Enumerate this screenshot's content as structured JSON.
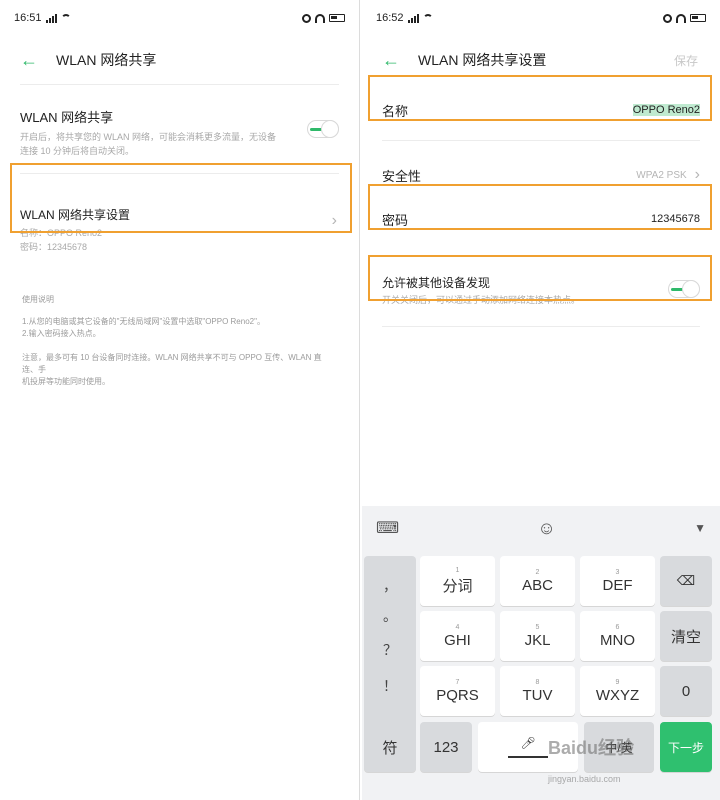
{
  "left": {
    "status": {
      "time": "16:51",
      "net": "4G"
    },
    "title": "WLAN 网络共享",
    "hotspot": {
      "label": "WLAN 网络共享",
      "desc1": "开启后，将共享您的 WLAN 网络，可能会消耗更多流量，无设备",
      "desc2": "连接 10 分钟后将自动关闭。",
      "enabled": true
    },
    "settings": {
      "label": "WLAN 网络共享设置",
      "name_line": "名称：OPPO Reno2",
      "pwd_line": "密码：12345678"
    },
    "tips": {
      "heading": "使用说明",
      "line1": "1.从您的电脑或其它设备的\"无线局域网\"设置中选取\"OPPO Reno2\"。",
      "line2": "2.输入密码接入热点。",
      "line3": "注意，最多可有 10 台设备同时连接。WLAN 网络共享不可与 OPPO 互传、WLAN 直连、手",
      "line4": "机投屏等功能同时使用。"
    }
  },
  "right": {
    "status": {
      "time": "16:52",
      "net": "4G"
    },
    "title": "WLAN 网络共享设置",
    "save": "保存",
    "name": {
      "label": "名称",
      "value": "OPPO Reno2"
    },
    "security": {
      "label": "安全性",
      "value": "WPA2 PSK"
    },
    "password": {
      "label": "密码",
      "value": "12345678"
    },
    "discover": {
      "label": "允许被其他设备发现",
      "desc": "开关关闭后，可以通过手动添加网络连接本热点。",
      "enabled": true
    }
  },
  "keyboard": {
    "sym1": "，",
    "sym2": "。",
    "sym3": "？",
    "sym4": "！",
    "k1_num": "1",
    "k1": "分词",
    "k2_num": "2",
    "k2": "ABC",
    "k3_num": "3",
    "k3": "DEF",
    "k4_num": "4",
    "k4": "GHI",
    "k5_num": "5",
    "k5": "JKL",
    "k6_num": "6",
    "k6": "MNO",
    "k7_num": "7",
    "k7": "PQRS",
    "k8_num": "8",
    "k8": "TUV",
    "k9_num": "9",
    "k9": "WXYZ",
    "clear": "清空",
    "zero": "0",
    "fu": "符",
    "num123": "123",
    "zh": "中/英",
    "next": "下一步"
  },
  "watermark": {
    "brand": "Baidu经验",
    "url": "jingyan.baidu.com"
  }
}
